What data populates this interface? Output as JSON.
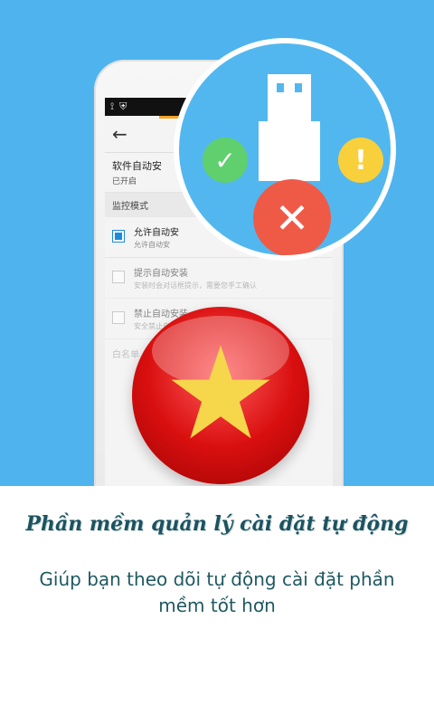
{
  "phone": {
    "status_icons": [
      "usb-icon",
      "shield-icon"
    ],
    "back_icon": "back-arrow-icon",
    "setting_title": "软件自动安",
    "setting_status": "已开启",
    "section_label": "监控模式",
    "options": [
      {
        "title": "允许自动安",
        "desc": "允许自动安",
        "checked": true
      },
      {
        "title": "提示自动安装",
        "desc": "安装时会对话框提示，需要您手工确认",
        "checked": false
      },
      {
        "title": "禁止自动安装",
        "desc": "安全禁止自动安装软件的行为",
        "checked": false
      }
    ],
    "whitelist_label": "白名单"
  },
  "magnifier": {
    "icons": [
      "usb-plug-icon",
      "check-icon",
      "warning-icon",
      "close-icon"
    ],
    "check": "✓",
    "warn": "!",
    "error": "✕"
  },
  "colors": {
    "hero_bg": "#4fb3ee",
    "check": "#5fd06d",
    "warning": "#f8d03b",
    "error": "#ef5a47",
    "badge": "#d90f0f",
    "star": "#f6d64b"
  },
  "badge": {
    "icon": "vietnam-star-badge-icon"
  },
  "content": {
    "title": "Phần mềm quản lý cài đặt tự động",
    "subtitle": "Giúp bạn theo dõi tự động cài đặt phần mềm tốt hơn"
  }
}
